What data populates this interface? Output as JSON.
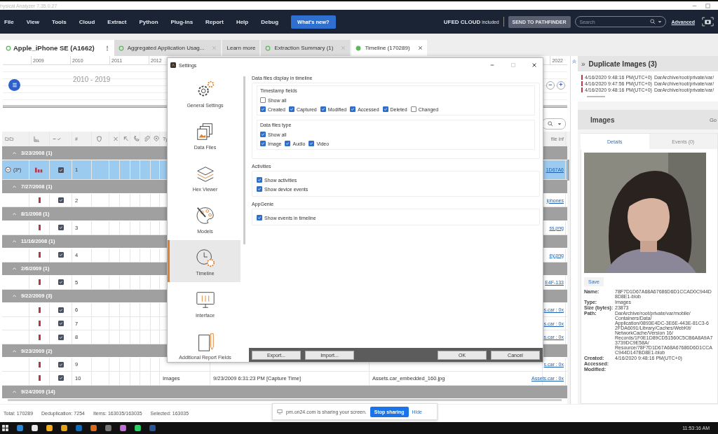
{
  "window": {
    "title": "hysical Analyzer 7.35.0.27"
  },
  "menu": {
    "items": [
      "File",
      "View",
      "Tools",
      "Cloud",
      "Extract",
      "Python",
      "Plug-ins",
      "Report",
      "Help",
      "Debug"
    ],
    "whats_new": "What's new?",
    "cloud": "UFED CLOUD",
    "cloud_note": "included",
    "pathfinder": "SEND TO PATHFINDER",
    "search": {
      "placeholder": "Search"
    },
    "advanced": "Advanced"
  },
  "device": {
    "name": "Apple_iPhone SE (A1662)",
    "more": "⋮"
  },
  "tabs": [
    {
      "label": "Aggregated Application Usag...",
      "selected": false,
      "status": true,
      "closable": true
    },
    {
      "label": "Learn more",
      "selected": false,
      "status": false,
      "closable": false
    },
    {
      "label": "Extraction Summary (1)",
      "selected": false,
      "status": true,
      "closable": true
    },
    {
      "label": "Timeline (170289)",
      "selected": true,
      "status": true,
      "closable": true
    }
  ],
  "timeline": {
    "years": [
      "2009",
      "2010",
      "2011",
      "2012"
    ],
    "last_year": "2022",
    "band": "2010 - 2019",
    "zoom_out": "−",
    "zoom_in": "+"
  },
  "table": {
    "number_header": "#",
    "type_header": "Ty",
    "link_header": "file inf",
    "groups": [
      {
        "label": "3/23/2008 (1)",
        "rows": [
          {
            "number": "1",
            "selected": true,
            "checked": true,
            "badge": "(3*)",
            "link": "1D67A6"
          }
        ]
      },
      {
        "label": "7/27/2008 (1)",
        "rows": [
          {
            "number": "2",
            "selected": false,
            "checked": true,
            "link": "iphones"
          }
        ]
      },
      {
        "label": "8/1/2008 (1)",
        "rows": [
          {
            "number": "3",
            "selected": false,
            "checked": true,
            "link": "ss.png"
          }
        ]
      },
      {
        "label": "11/16/2008 (1)",
        "rows": [
          {
            "number": "4",
            "selected": false,
            "checked": true,
            "link": "ey.png"
          }
        ]
      },
      {
        "label": "2/6/2009 (1)",
        "rows": [
          {
            "number": "5",
            "selected": false,
            "checked": true,
            "link": "E4F-133"
          }
        ]
      },
      {
        "label": "9/22/2009 (3)",
        "rows": [
          {
            "number": "6",
            "selected": false,
            "checked": true,
            "link": "s.car : 0x"
          },
          {
            "number": "7",
            "selected": false,
            "checked": true,
            "link": "s.car : 0x"
          },
          {
            "number": "8",
            "selected": false,
            "checked": true,
            "link": "s.car : 0x"
          }
        ]
      },
      {
        "label": "9/23/2009 (2)",
        "rows": [
          {
            "number": "9",
            "selected": false,
            "checked": true,
            "link": "s.car : 0x"
          },
          {
            "number": "10",
            "selected": false,
            "checked": true,
            "type": "Images",
            "time": "9/23/2009 6:31:23 PM [Capture Time]",
            "file": "Assets.car_embedded_160.jpg",
            "link": "Assets.car : 0x"
          }
        ]
      },
      {
        "label": "9/24/2009 (14)"
      }
    ]
  },
  "status_bar": [
    "Total: 170289",
    "Deduplication: 7254",
    "Items: 163035/163035",
    "Selected: 163035"
  ],
  "screen_share": {
    "message": "pm.on24.com is sharing your screen.",
    "stop": "Stop sharing",
    "hide": "Hide"
  },
  "settings": {
    "title": "Settings",
    "nav": [
      {
        "label": "General Settings",
        "selected": false
      },
      {
        "label": "Data Files",
        "selected": false
      },
      {
        "label": "Hex Viewer",
        "selected": false
      },
      {
        "label": "Models",
        "selected": false
      },
      {
        "label": "Timeline",
        "selected": true
      },
      {
        "label": "Interface",
        "selected": false
      },
      {
        "label": "Additional Report Fields",
        "selected": false
      }
    ],
    "sections": [
      {
        "title": "Data files display in timeline",
        "groups": [
          {
            "title": "Timestamp fields",
            "rows": [
              [
                {
                  "label": "Show all",
                  "checked": false
                }
              ],
              [
                {
                  "label": "Created",
                  "checked": true
                },
                {
                  "label": "Captured",
                  "checked": true
                },
                {
                  "label": "Modified",
                  "checked": true
                },
                {
                  "label": "Accessed",
                  "checked": true
                },
                {
                  "label": "Deleted",
                  "checked": true
                },
                {
                  "label": "Changed",
                  "checked": false
                }
              ]
            ]
          },
          {
            "title": "Data files type",
            "rows": [
              [
                {
                  "label": "Show all",
                  "checked": true
                }
              ],
              [
                {
                  "label": "Image",
                  "checked": true
                },
                {
                  "label": "Audio",
                  "checked": true
                },
                {
                  "label": "Video",
                  "checked": true
                }
              ]
            ]
          }
        ]
      },
      {
        "title": "Activities",
        "groups": [
          {
            "rows": [
              [
                {
                  "label": "Show activities",
                  "checked": true
                }
              ],
              [
                {
                  "label": "Show device events",
                  "checked": true
                }
              ]
            ]
          }
        ]
      },
      {
        "title": "AppGenie",
        "groups": [
          {
            "rows": [
              [
                {
                  "label": "Show events in timeline",
                  "checked": true
                }
              ]
            ]
          }
        ]
      }
    ],
    "buttons_left": [
      "Export...",
      "Import..."
    ],
    "buttons_right": [
      "OK",
      "Cancel"
    ]
  },
  "details": {
    "collapse": "»",
    "title": "Duplicate Images (3)",
    "duplicates": [
      {
        "time": "4/16/2020 9:48:16 PM(UTC+0)",
        "path": "DarArchive/root/private/var/"
      },
      {
        "time": "4/16/2020 9:47:56 PM(UTC+0)",
        "path": "DarArchive/root/private/var/"
      },
      {
        "time": "4/16/2020 9:48:16 PM(UTC+0)",
        "path": "DarArchive/root/private/var/"
      }
    ],
    "images_title": "Images",
    "go": "Go",
    "tabs": [
      {
        "label": "Details",
        "selected": true
      },
      {
        "label": "Events (0)",
        "selected": false
      }
    ],
    "save": "Save",
    "props": [
      {
        "label": "Name:",
        "lines": [
          "78F7D1D67A68A67686D6D1CCAD0C944D",
          "8D8E1-blob"
        ]
      },
      {
        "label": "Type:",
        "lines": [
          "Images"
        ]
      },
      {
        "label": "Size (bytes):",
        "lines": [
          "23873"
        ]
      },
      {
        "label": "Path:",
        "lines": [
          "DarArchive/root/private/var/mobile/",
          "Containers/Data/",
          "Application/0893E4DC-3E6E-443E-81C3-6",
          "2FDA6091/Library/Caches/WebKit/",
          "NetworkCache/Version 16/",
          "Records/1F0E1D89CD51560C5CB6A8A9A7",
          "3739DC9E58A/",
          "Resource/78F7D1D67A68A67686D6D1CCA",
          "C944D147BD8E1-blob"
        ]
      },
      {
        "label": "Created:",
        "lines": [
          "4/16/2020 9:48:16 PM(UTC+0)"
        ]
      },
      {
        "label": "Accessed:"
      },
      {
        "label": "Modified:"
      }
    ]
  },
  "taskbar": {
    "clock": "11:53:16 AM"
  }
}
